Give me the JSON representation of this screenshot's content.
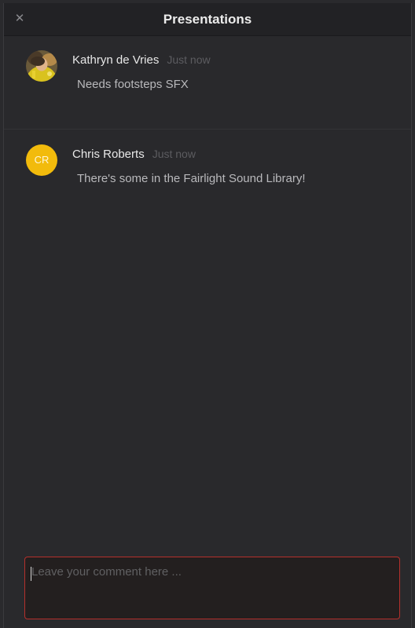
{
  "window": {
    "title": "Presentations",
    "close_glyph": "✕"
  },
  "comments": [
    {
      "author": "Kathryn de Vries",
      "timestamp": "Just now",
      "text": "Needs footsteps SFX",
      "avatar": {
        "type": "photo",
        "icon": "user-photo"
      }
    },
    {
      "author": "Chris Roberts",
      "timestamp": "Just now",
      "text": "There's some in the Fairlight Sound Library!",
      "avatar": {
        "type": "initials",
        "initials": "CR",
        "color": "#f2bb0c"
      }
    }
  ],
  "comment_input": {
    "value": "",
    "placeholder": "Leave your comment here ...",
    "border_color": "#b5302c"
  }
}
